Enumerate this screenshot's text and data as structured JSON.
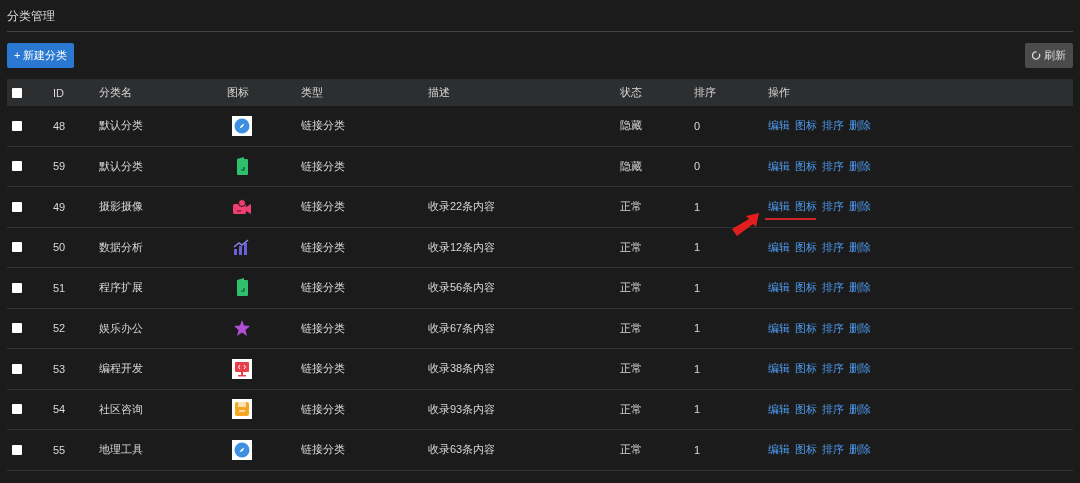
{
  "page_title": "分类管理",
  "toolbar": {
    "new_button": "+ 新建分类",
    "refresh_button": "刷新"
  },
  "table": {
    "header_checkbox": {
      "checked": false
    },
    "columns": [
      "ID",
      "分类名",
      "图标",
      "类型",
      "描述",
      "状态",
      "排序",
      "操作"
    ],
    "rows": [
      {
        "checked": false,
        "id": "48",
        "name": "默认分类",
        "icon": {
          "kind": "compass"
        },
        "type": "链接分类",
        "description": "",
        "status": "隐藏",
        "sort": "0",
        "actions": [
          "编辑",
          "图标",
          "排序",
          "删除"
        ]
      },
      {
        "checked": false,
        "id": "59",
        "name": "默认分类",
        "icon": {
          "kind": "book"
        },
        "type": "链接分类",
        "description": "",
        "status": "隐藏",
        "sort": "0",
        "actions": [
          "编辑",
          "图标",
          "排序",
          "删除"
        ]
      },
      {
        "checked": false,
        "id": "49",
        "name": "摄影摄像",
        "icon": {
          "kind": "camera"
        },
        "type": "链接分类",
        "description": "收录22条内容",
        "status": "正常",
        "sort": "1",
        "actions": [
          "编辑",
          "图标",
          "排序",
          "删除"
        ]
      },
      {
        "checked": false,
        "id": "50",
        "name": "数据分析",
        "icon": {
          "kind": "chart"
        },
        "type": "链接分类",
        "description": "收录12条内容",
        "status": "正常",
        "sort": "1",
        "actions": [
          "编辑",
          "图标",
          "排序",
          "删除"
        ]
      },
      {
        "checked": false,
        "id": "51",
        "name": "程序扩展",
        "icon": {
          "kind": "book"
        },
        "type": "链接分类",
        "description": "收录56条内容",
        "status": "正常",
        "sort": "1",
        "actions": [
          "编辑",
          "图标",
          "排序",
          "删除"
        ]
      },
      {
        "checked": false,
        "id": "52",
        "name": "娱乐办公",
        "icon": {
          "kind": "star"
        },
        "type": "链接分类",
        "description": "收录67条内容",
        "status": "正常",
        "sort": "1",
        "actions": [
          "编辑",
          "图标",
          "排序",
          "删除"
        ]
      },
      {
        "checked": false,
        "id": "53",
        "name": "编程开发",
        "icon": {
          "kind": "code"
        },
        "type": "链接分类",
        "description": "收录38条内容",
        "status": "正常",
        "sort": "1",
        "actions": [
          "编辑",
          "图标",
          "排序",
          "删除"
        ]
      },
      {
        "checked": false,
        "id": "54",
        "name": "社区咨询",
        "icon": {
          "kind": "save"
        },
        "type": "链接分类",
        "description": "收录93条内容",
        "status": "正常",
        "sort": "1",
        "actions": [
          "编辑",
          "图标",
          "排序",
          "删除"
        ]
      },
      {
        "checked": false,
        "id": "55",
        "name": "地理工具",
        "icon": {
          "kind": "compass"
        },
        "type": "链接分类",
        "description": "收录63条内容",
        "status": "正常",
        "sort": "1",
        "actions": [
          "编辑",
          "图标",
          "排序",
          "删除"
        ]
      }
    ]
  }
}
